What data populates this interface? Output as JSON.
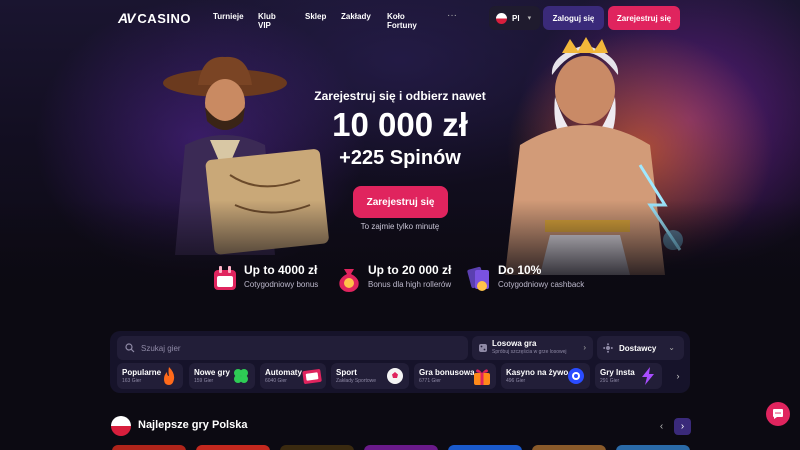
{
  "header": {
    "logo_mark": "AV",
    "logo_text": "CASINO",
    "nav": [
      "Turnieje",
      "Klub VIP",
      "Sklep",
      "Zakłady",
      "Koło Fortuny"
    ],
    "more": "···",
    "language": "Pl",
    "login_label": "Zaloguj się",
    "register_label": "Zarejestruj się"
  },
  "hero": {
    "subtitle": "Zarejestruj się i odbierz nawet",
    "amount": "10 000 zł",
    "spins": "+225 Spinów",
    "cta_label": "Zarejestruj się",
    "note": "To zajmie tylko minutę"
  },
  "promos": [
    {
      "title": "Up to 4000 zł",
      "desc": "Cotygodniowy bonus",
      "icon": "calendar-gift-icon"
    },
    {
      "title": "Up to 20 000 zł",
      "desc": "Bonus dla high rollerów",
      "icon": "money-bag-icon"
    },
    {
      "title": "Do 10%",
      "desc": "Cotygodniowy cashback",
      "icon": "cashback-cards-icon"
    }
  ],
  "games": {
    "search_placeholder": "Szukaj gier",
    "random": {
      "title": "Losowa gra",
      "sub": "Spróbuj szczęścia w grze losowej"
    },
    "providers_label": "Dostawcy",
    "categories": [
      {
        "title": "Popularne",
        "count": "163 Gier",
        "icon": "fire-icon"
      },
      {
        "title": "Nowe gry",
        "count": "159 Gier",
        "icon": "clover-icon"
      },
      {
        "title": "Automaty",
        "count": "6040 Gier",
        "icon": "slot-777-icon"
      },
      {
        "title": "Sport",
        "count": "Zakłady Sportowe",
        "icon": "football-icon"
      },
      {
        "title": "Gra bonusowa",
        "count": "6771 Gier",
        "icon": "gift-icon"
      },
      {
        "title": "Kasyno na żywo",
        "count": "496 Gier",
        "icon": "live-casino-icon"
      },
      {
        "title": "Gry Insta",
        "count": "291 Gier",
        "icon": "lightning-icon"
      }
    ]
  },
  "section": {
    "title": "Najlepsze gry Polska"
  },
  "colors": {
    "accent": "#e0245e",
    "secondary": "#3a2a7a",
    "panel": "#16132a",
    "background": "#0c0a12"
  }
}
